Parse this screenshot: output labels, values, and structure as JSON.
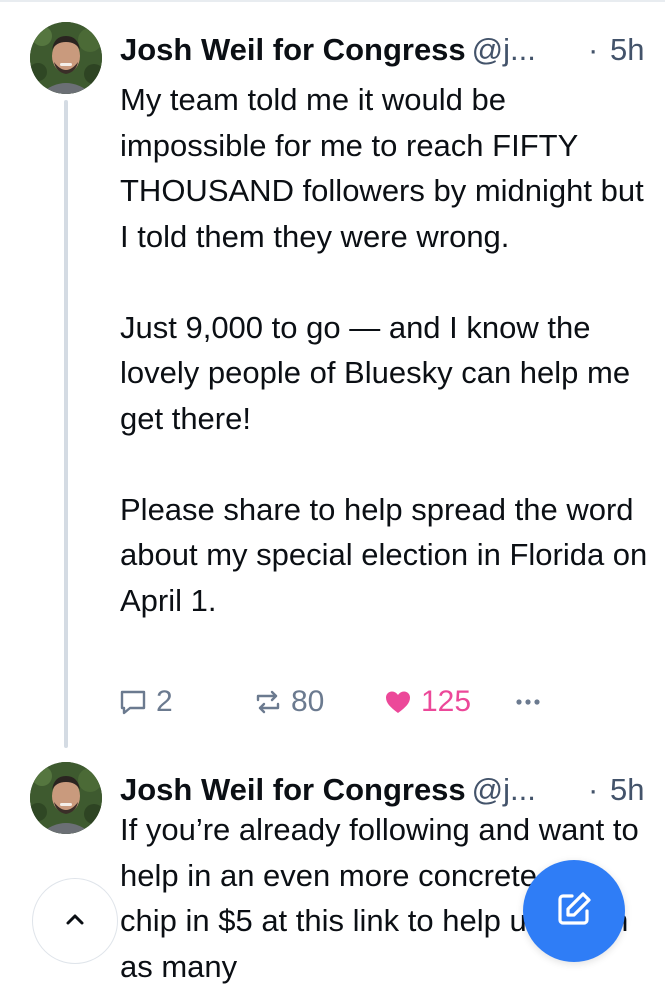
{
  "posts": [
    {
      "display_name": "Josh Weil for Congress",
      "handle": "@j...",
      "separator": "·",
      "time": "5h",
      "paragraphs": [
        "My team told me it would be impossible for me to reach FIFTY THOUSAND followers by midnight but I told them they were wrong.",
        "Just 9,000 to go — and I know the lovely people of Bluesky can help me get there!",
        "Please share to help spread the word about my special election in Florida on April 1."
      ],
      "replies": "2",
      "reposts": "80",
      "likes": "125",
      "liked": true
    },
    {
      "display_name": "Josh Weil for Congress",
      "handle": "@j...",
      "separator": "·",
      "time": "5h",
      "paragraphs": [
        "If you’re already following and want to help in an even more concrete way, chip in $5 at this link to help us reach as many"
      ]
    }
  ],
  "icons": {
    "reply": "speech-bubble-icon",
    "repost": "repost-arrows-icon",
    "like": "heart-icon",
    "more": "ellipsis-icon",
    "scroll_top": "chevron-up-icon",
    "compose": "pencil-square-icon"
  },
  "colors": {
    "like_active": "#ec4899",
    "fab": "#2f7df6",
    "muted": "#6b7a8f",
    "thread_line": "#d4dbe3"
  }
}
